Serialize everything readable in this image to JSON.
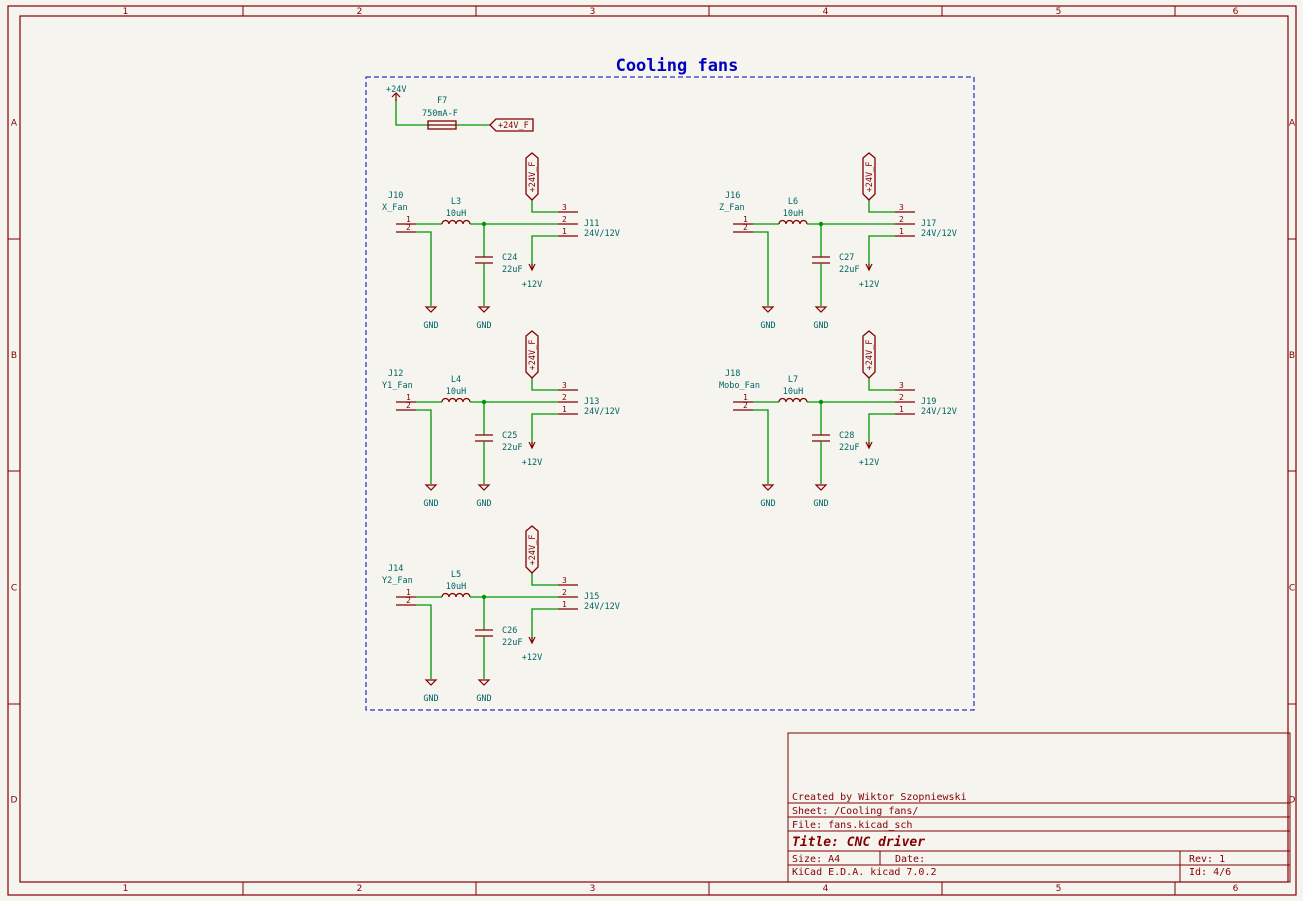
{
  "sheet": {
    "title": "Cooling fans",
    "columns": [
      "1",
      "2",
      "3",
      "4",
      "5",
      "6"
    ],
    "rows": [
      "A",
      "B",
      "C",
      "D"
    ]
  },
  "supply": {
    "power": "+24V",
    "fuse_ref": "F7",
    "fuse_value": "750mA-F",
    "net_label": "+24V_F"
  },
  "fan_blocks": [
    {
      "fan_ref": "J10",
      "fan_name": "X_Fan",
      "ind_ref": "L3",
      "ind_val": "10uH",
      "cap_ref": "C24",
      "cap_val": "22uF",
      "sel_ref": "J11",
      "sel_val": "24V/12V",
      "gnd1": "GND",
      "gnd2": "GND",
      "v12": "+12V",
      "v24f": "+24V_F"
    },
    {
      "fan_ref": "J16",
      "fan_name": "Z_Fan",
      "ind_ref": "L6",
      "ind_val": "10uH",
      "cap_ref": "C27",
      "cap_val": "22uF",
      "sel_ref": "J17",
      "sel_val": "24V/12V",
      "gnd1": "GND",
      "gnd2": "GND",
      "v12": "+12V",
      "v24f": "+24V_F"
    },
    {
      "fan_ref": "J12",
      "fan_name": "Y1_Fan",
      "ind_ref": "L4",
      "ind_val": "10uH",
      "cap_ref": "C25",
      "cap_val": "22uF",
      "sel_ref": "J13",
      "sel_val": "24V/12V",
      "gnd1": "GND",
      "gnd2": "GND",
      "v12": "+12V",
      "v24f": "+24V_F"
    },
    {
      "fan_ref": "J18",
      "fan_name": "Mobo_Fan",
      "ind_ref": "L7",
      "ind_val": "10uH",
      "cap_ref": "C28",
      "cap_val": "22uF",
      "sel_ref": "J19",
      "sel_val": "24V/12V",
      "gnd1": "GND",
      "gnd2": "GND",
      "v12": "+12V",
      "v24f": "+24V_F"
    },
    {
      "fan_ref": "J14",
      "fan_name": "Y2_Fan",
      "ind_ref": "L5",
      "ind_val": "10uH",
      "cap_ref": "C26",
      "cap_val": "22uF",
      "sel_ref": "J15",
      "sel_val": "24V/12V",
      "gnd1": "GND",
      "gnd2": "GND",
      "v12": "+12V",
      "v24f": "+24V_F"
    }
  ],
  "pins": {
    "p1": "1",
    "p2": "2",
    "p3": "3"
  },
  "title_block": {
    "created_by": "Created by Wiktor Szopniewski",
    "sheet": "Sheet: /Cooling fans/",
    "file": "File: fans.kicad_sch",
    "title": "Title: CNC driver",
    "size": "Size: A4",
    "date": "Date:",
    "rev": "Rev: 1",
    "tool": "KiCad E.D.A.  kicad 7.0.2",
    "id": "Id: 4/6"
  },
  "colors": {
    "frame": "#840000",
    "wire": "#009600",
    "ref_text": "#006464",
    "sheet_title": "#0000c0",
    "background": "#f5f4ef"
  }
}
